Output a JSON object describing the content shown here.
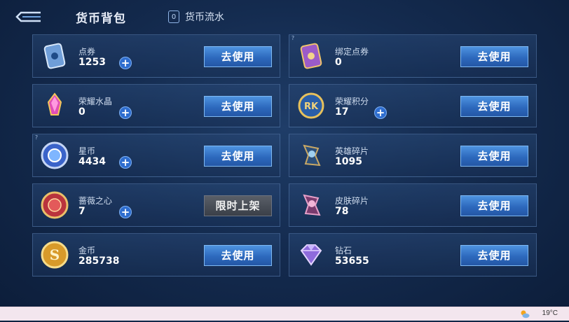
{
  "header": {
    "title": "货币背包",
    "flow_label": "货币流水"
  },
  "currencies": [
    {
      "name": "点券",
      "amount": "1253",
      "button": "去使用",
      "plus": true
    },
    {
      "name": "绑定点券",
      "amount": "0",
      "button": "去使用",
      "plus": false
    },
    {
      "name": "荣耀水晶",
      "amount": "0",
      "button": "去使用",
      "plus": true
    },
    {
      "name": "荣耀积分",
      "amount": "17",
      "button": "去使用",
      "plus": true
    },
    {
      "name": "星币",
      "amount": "4434",
      "button": "去使用",
      "plus": true
    },
    {
      "name": "英雄碎片",
      "amount": "1095",
      "button": "去使用",
      "plus": false
    },
    {
      "name": "蔷薇之心",
      "amount": "7",
      "button": "限时上架",
      "plus": true
    },
    {
      "name": "皮肤碎片",
      "amount": "78",
      "button": "去使用",
      "plus": false
    },
    {
      "name": "金币",
      "amount": "285738",
      "button": "去使用",
      "plus": false
    },
    {
      "name": "钻石",
      "amount": "53655",
      "button": "去使用",
      "plus": false
    }
  ],
  "taskbar": {
    "temperature": "19°C"
  }
}
